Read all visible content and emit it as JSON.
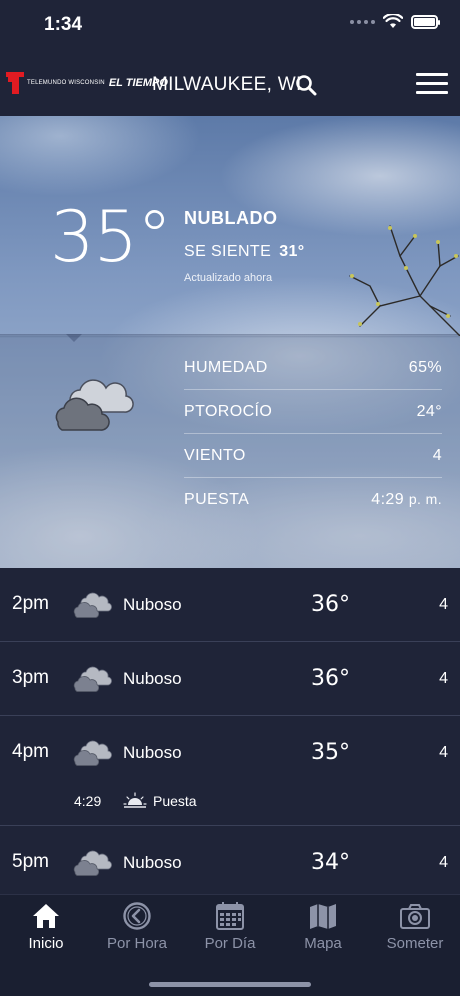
{
  "status_bar": {
    "time": "1:34"
  },
  "header": {
    "logo_small": "TELEMUNDO WISCONSIN",
    "logo_brand": "EL TIEMPO",
    "city": "MILWAUKEE, WI"
  },
  "current": {
    "temp": "35°",
    "condition": "NUBLADO",
    "feels_label": "SE SIENTE",
    "feels_value": "31°",
    "updated": "Actualizado ahora"
  },
  "details": [
    {
      "label": "HUMEDAD",
      "value": "65%"
    },
    {
      "label": "PTOROCÍO",
      "value": "24°"
    },
    {
      "label": "VIENTO",
      "value": "4"
    },
    {
      "label": "PUESTA",
      "value": "4:29",
      "suffix": "p. m."
    }
  ],
  "hourly": [
    {
      "time": "2pm",
      "condition": "Nuboso",
      "temp": "36°",
      "wind": "4"
    },
    {
      "time": "3pm",
      "condition": "Nuboso",
      "temp": "36°",
      "wind": "4"
    },
    {
      "time": "4pm",
      "condition": "Nuboso",
      "temp": "35°",
      "wind": "4",
      "event_time": "4:29",
      "event_label": "Puesta"
    },
    {
      "time": "5pm",
      "condition": "Nuboso",
      "temp": "34°",
      "wind": "4"
    }
  ],
  "nav": [
    {
      "label": "Inicio",
      "icon": "home-icon",
      "active": true
    },
    {
      "label": "Por Hora",
      "icon": "clock-icon",
      "active": false
    },
    {
      "label": "Por Día",
      "icon": "calendar-icon",
      "active": false
    },
    {
      "label": "Mapa",
      "icon": "map-icon",
      "active": false
    },
    {
      "label": "Someter",
      "icon": "camera-icon",
      "active": false
    }
  ],
  "colors": {
    "background": "#1f2438",
    "logo_red": "#e11b22",
    "nav_inactive": "#8d93a8"
  }
}
